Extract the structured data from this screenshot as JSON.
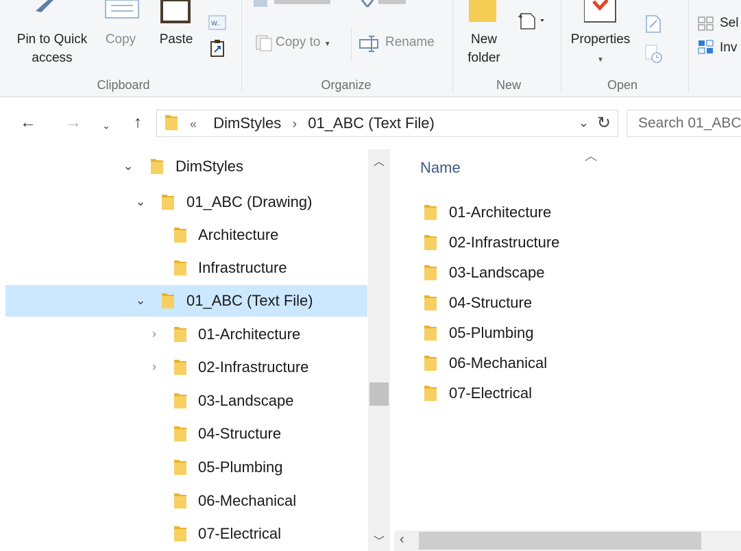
{
  "ribbon": {
    "groups": {
      "clipboard": "Clipboard",
      "organize": "Organize",
      "new": "New",
      "open": "Open"
    },
    "pin_to_quick_access": "Pin to Quick\naccess",
    "copy": "Copy",
    "paste": "Paste",
    "copy_to": "Copy to",
    "rename": "Rename",
    "new_folder": "New\nfolder",
    "properties": "Properties",
    "select_all": "Sel",
    "invert_selection": "Inv"
  },
  "address": {
    "overflow": "«",
    "crumbs": [
      "DimStyles",
      "01_ABC (Text File)"
    ],
    "search_placeholder": "Search 01_ABC"
  },
  "tree": [
    {
      "label": "DimStyles",
      "expanded": true
    },
    {
      "label": "01_ABC (Drawing)",
      "expanded": true
    },
    {
      "label": "Architecture"
    },
    {
      "label": "Infrastructure"
    },
    {
      "label": "01_ABC (Text File)",
      "expanded": true,
      "selected": true
    },
    {
      "label": "01-Architecture",
      "expandable": true
    },
    {
      "label": "02-Infrastructure",
      "expandable": true
    },
    {
      "label": "03-Landscape"
    },
    {
      "label": "04-Structure"
    },
    {
      "label": "05-Plumbing"
    },
    {
      "label": "06-Mechanical"
    },
    {
      "label": "07-Electrical"
    }
  ],
  "content": {
    "column_name": "Name",
    "items": [
      "01-Architecture",
      "02-Infrastructure",
      "03-Landscape",
      "04-Structure",
      "05-Plumbing",
      "06-Mechanical",
      "07-Electrical"
    ]
  },
  "colors": {
    "folder": "#f2c94c",
    "selection": "#cce8ff",
    "column_header": "#3b5b81"
  }
}
